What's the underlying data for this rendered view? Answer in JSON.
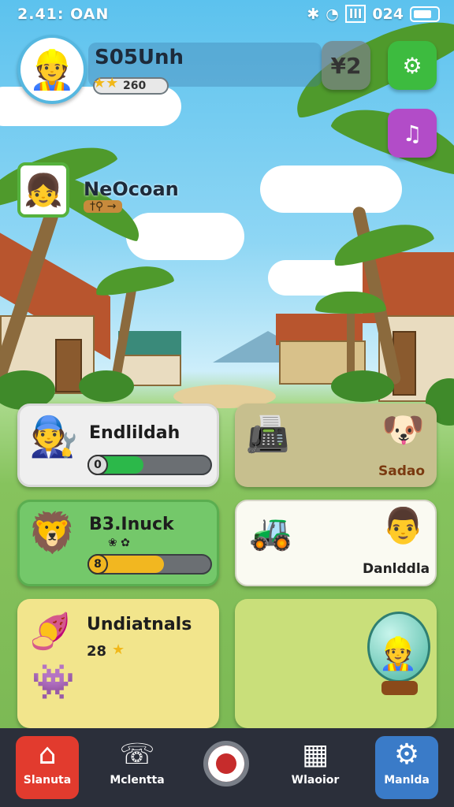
{
  "status_bar": {
    "time": "2.41: OAN",
    "indicator": "024"
  },
  "header": {
    "player_name": "S05Unh",
    "level": "260",
    "count_button": "¥2",
    "settings_icon": "gear-icon",
    "music_icon": "music-icon"
  },
  "friend": {
    "name": "NeOcoan",
    "icons": "†⚲ →"
  },
  "cards": [
    {
      "title": "Endlildah",
      "progress_number": "0",
      "progress_fraction": 0.45,
      "progress_color": "#2cb84a",
      "icon": "worker-icon"
    },
    {
      "label": "Sadao",
      "icon": "dog-icon"
    },
    {
      "title": "B3.Inuck",
      "subtitle": "❀ ✿",
      "progress_number": "8",
      "progress_fraction": 0.62,
      "progress_color": "#f2b720",
      "icon": "lion-icon"
    },
    {
      "label": "Danlddla",
      "icon": "farmer-icon"
    },
    {
      "title": "Undiatnals",
      "subtitle": "28",
      "icon": "monster-icon"
    },
    {
      "icon": "globe-icon"
    }
  ],
  "nav": [
    {
      "label": "Slanuta",
      "icon": "home-icon",
      "color": "#e23b2e"
    },
    {
      "label": "Mclentta",
      "icon": "phone-icon"
    },
    {
      "label": "",
      "icon": "record-icon"
    },
    {
      "label": "Wlaoior",
      "icon": "grid-icon"
    },
    {
      "label": "Manlda",
      "icon": "gear-icon",
      "color": "#3a7bc8"
    }
  ]
}
